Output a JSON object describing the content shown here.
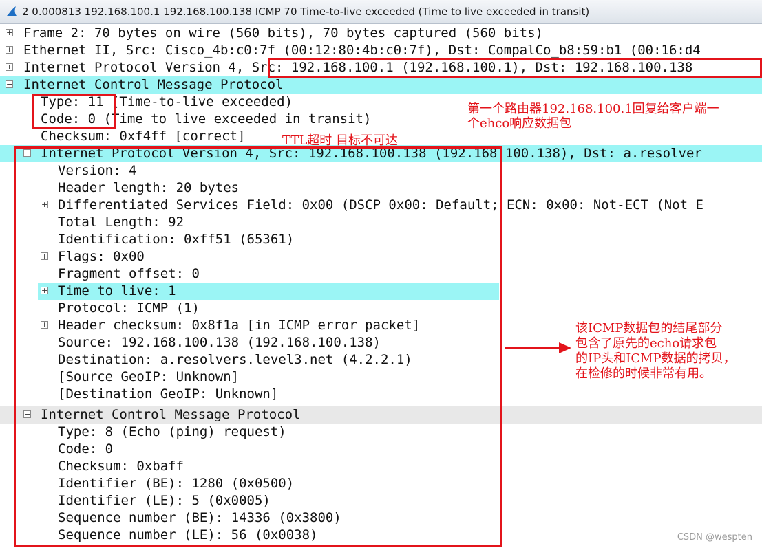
{
  "title_bar": {
    "text": "2 0.000813 192.168.100.1 192.168.100.138 ICMP 70 Time-to-live exceeded (Time to live exceeded in transit)",
    "icon": "wireshark-fin-icon"
  },
  "tree_rows": [
    {
      "toggle": "+",
      "text": "Frame 2: 70 bytes on wire (560 bits), 70 bytes captured (560 bits)"
    },
    {
      "toggle": "+",
      "text": "Ethernet II, Src: Cisco_4b:c0:7f (00:12:80:4b:c0:7f), Dst: CompalCo_b8:59:b1 (00:16:d4"
    },
    {
      "toggle": "+",
      "text": "Internet Protocol Version 4, Src: 192.168.100.1 (192.168.100.1), Dst: 192.168.100.138"
    },
    {
      "toggle": "−",
      "text": "Internet Control Message Protocol"
    },
    {
      "toggle": "",
      "text": "Type: 11 (Time-to-live exceeded)"
    },
    {
      "toggle": "",
      "text": "Code: 0 (Time to live exceeded in transit)"
    },
    {
      "toggle": "",
      "text": "Checksum: 0xf4ff [correct]"
    },
    {
      "toggle": "−",
      "text": "Internet Protocol Version 4, Src: 192.168.100.138 (192.168.100.138), Dst: a.resolver"
    },
    {
      "toggle": "",
      "text": "Version: 4"
    },
    {
      "toggle": "",
      "text": "Header length: 20 bytes"
    },
    {
      "toggle": "+",
      "text": "Differentiated Services Field: 0x00 (DSCP 0x00: Default; ECN: 0x00: Not-ECT (Not E"
    },
    {
      "toggle": "",
      "text": "Total Length: 92"
    },
    {
      "toggle": "",
      "text": "Identification: 0xff51 (65361)"
    },
    {
      "toggle": "+",
      "text": "Flags: 0x00"
    },
    {
      "toggle": "",
      "text": "Fragment offset: 0"
    },
    {
      "toggle": "+",
      "text": "Time to live: 1"
    },
    {
      "toggle": "",
      "text": "Protocol: ICMP (1)"
    },
    {
      "toggle": "+",
      "text": "Header checksum: 0x8f1a [in ICMP error packet]"
    },
    {
      "toggle": "",
      "text": "Source: 192.168.100.138 (192.168.100.138)"
    },
    {
      "toggle": "",
      "text": "Destination: a.resolvers.level3.net (4.2.2.1)"
    },
    {
      "toggle": "",
      "text": "[Source GeoIP: Unknown]"
    },
    {
      "toggle": "",
      "text": "[Destination GeoIP: Unknown]"
    },
    {
      "toggle": "−",
      "text": "Internet Control Message Protocol"
    },
    {
      "toggle": "",
      "text": "Type: 8 (Echo (ping) request)"
    },
    {
      "toggle": "",
      "text": "Code: 0"
    },
    {
      "toggle": "",
      "text": "Checksum: 0xbaff"
    },
    {
      "toggle": "",
      "text": "Identifier (BE): 1280 (0x0500)"
    },
    {
      "toggle": "",
      "text": "Identifier (LE): 5 (0x0005)"
    },
    {
      "toggle": "",
      "text": "Sequence number (BE): 14336 (0x3800)"
    },
    {
      "toggle": "",
      "text": "Sequence number (LE): 56 (0x0038)"
    }
  ],
  "annotations": {
    "router_reply_line1": "第一个路由器192.168.100.1回复给客户端一",
    "router_reply_line2": "个ehco响应数据包",
    "ttl_note": "TTL超时 目标不可达",
    "tail_line1": "该ICMP数据包的结尾部分",
    "tail_line2": "包含了原先的echo请求包",
    "tail_line3": "的IP头和ICMP数据的拷贝，",
    "tail_line4": "在检修的时候非常有用。"
  },
  "watermark": "CSDN @wespten",
  "colors": {
    "highlight_row": "#9bf5f5",
    "annotation_red": "#e3141b"
  }
}
